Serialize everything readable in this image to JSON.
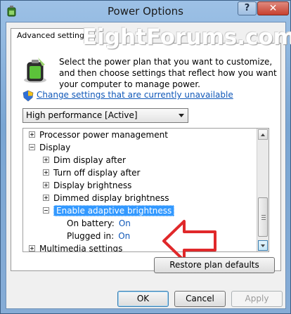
{
  "window": {
    "title": "Power Options",
    "help_label": "?",
    "close_label": "✕"
  },
  "tab": {
    "label": "Advanced settings"
  },
  "watermark": "EightForums.com",
  "description": "Select the power plan that you want to customize, and then choose settings that reflect how you want your computer to manage power.",
  "change_link": "Change settings that are currently unavailable",
  "plan_select": {
    "value": "High performance [Active]"
  },
  "tree": {
    "items": [
      {
        "label": "Processor power management",
        "expander": "plus"
      },
      {
        "label": "Display",
        "expander": "minus"
      },
      {
        "label": "Dim display after",
        "expander": "plus"
      },
      {
        "label": "Turn off display after",
        "expander": "plus"
      },
      {
        "label": "Display brightness",
        "expander": "plus"
      },
      {
        "label": "Dimmed display brightness",
        "expander": "plus"
      },
      {
        "label": "Enable adaptive brightness",
        "expander": "minus",
        "selected": true
      },
      {
        "label": "On battery:",
        "value": "On"
      },
      {
        "label": "Plugged in:",
        "value": "On"
      },
      {
        "label": "Multimedia settings",
        "expander": "plus"
      }
    ]
  },
  "buttons": {
    "restore": "Restore plan defaults",
    "ok": "OK",
    "cancel": "Cancel",
    "apply": "Apply"
  },
  "colors": {
    "link": "#0f57b8",
    "selection": "#3399ff",
    "arrow": "#e0282a",
    "close": "#c7402f"
  },
  "icons": [
    "power-options-icon",
    "battery-icon",
    "shield-icon",
    "red-arrow-icon"
  ]
}
